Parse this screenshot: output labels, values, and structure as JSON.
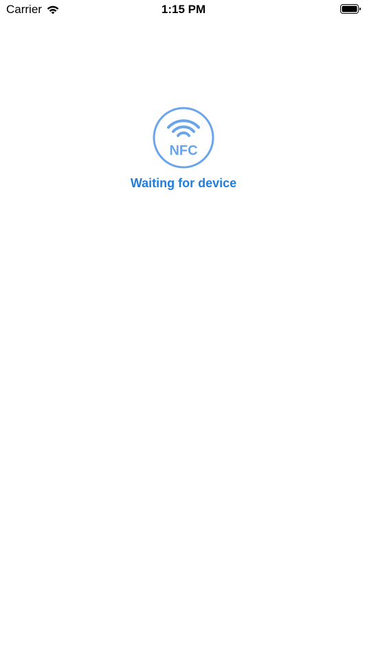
{
  "status_bar": {
    "carrier": "Carrier",
    "time": "1:15 PM",
    "wifi_icon": "wifi-icon",
    "battery_icon": "battery-icon"
  },
  "main": {
    "nfc_icon": "nfc-icon",
    "nfc_label": "NFC",
    "status_text": "Waiting for device",
    "accent_color": "#1f7ee0",
    "icon_color": "#6aa4ea"
  }
}
